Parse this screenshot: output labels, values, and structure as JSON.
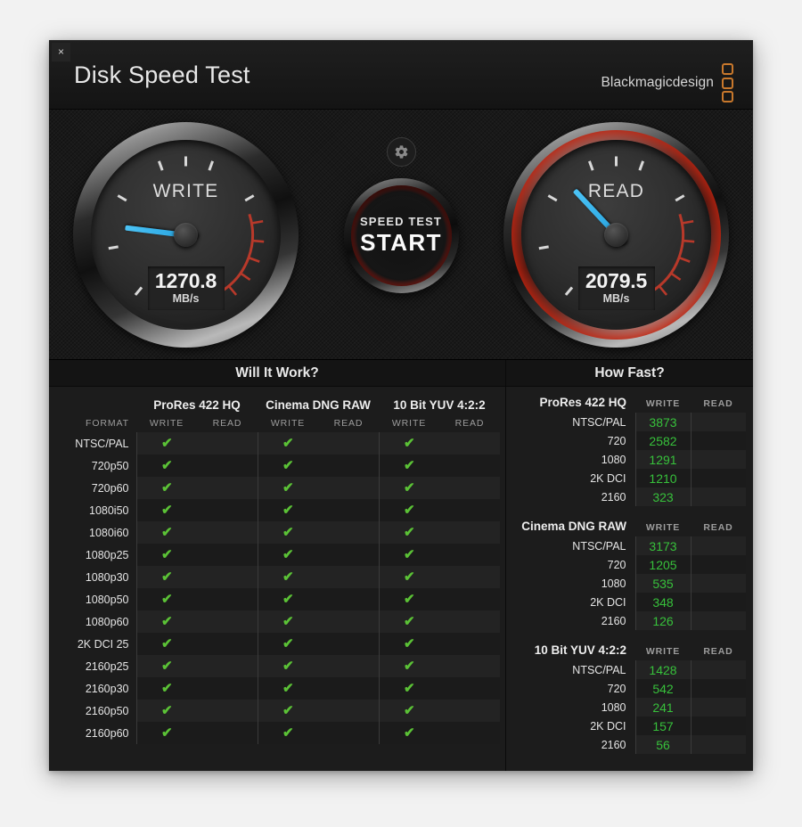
{
  "window": {
    "close_label": "×",
    "title": "Disk Speed Test",
    "brand": "Blackmagicdesign"
  },
  "gauges": {
    "write": {
      "label": "WRITE",
      "value": "1270.8",
      "unit": "MB/s",
      "needle_angle_deg": 187
    },
    "read": {
      "label": "READ",
      "value": "2079.5",
      "unit": "MB/s",
      "needle_angle_deg": 227
    }
  },
  "center": {
    "settings_icon": "gear-icon",
    "start_line1": "SPEED TEST",
    "start_line2": "START"
  },
  "will_it_work": {
    "title": "Will It Work?",
    "format_header": "FORMAT",
    "codecs": [
      "ProRes 422 HQ",
      "Cinema DNG RAW",
      "10 Bit YUV 4:2:2"
    ],
    "sub_headers": [
      "WRITE",
      "READ"
    ],
    "check_glyph": "✔",
    "rows": [
      {
        "format": "NTSC/PAL",
        "cells": [
          true,
          false,
          true,
          false,
          true,
          false
        ]
      },
      {
        "format": "720p50",
        "cells": [
          true,
          false,
          true,
          false,
          true,
          false
        ]
      },
      {
        "format": "720p60",
        "cells": [
          true,
          false,
          true,
          false,
          true,
          false
        ]
      },
      {
        "format": "1080i50",
        "cells": [
          true,
          false,
          true,
          false,
          true,
          false
        ]
      },
      {
        "format": "1080i60",
        "cells": [
          true,
          false,
          true,
          false,
          true,
          false
        ]
      },
      {
        "format": "1080p25",
        "cells": [
          true,
          false,
          true,
          false,
          true,
          false
        ]
      },
      {
        "format": "1080p30",
        "cells": [
          true,
          false,
          true,
          false,
          true,
          false
        ]
      },
      {
        "format": "1080p50",
        "cells": [
          true,
          false,
          true,
          false,
          true,
          false
        ]
      },
      {
        "format": "1080p60",
        "cells": [
          true,
          false,
          true,
          false,
          true,
          false
        ]
      },
      {
        "format": "2K DCI 25",
        "cells": [
          true,
          false,
          true,
          false,
          true,
          false
        ]
      },
      {
        "format": "2160p25",
        "cells": [
          true,
          false,
          true,
          false,
          true,
          false
        ]
      },
      {
        "format": "2160p30",
        "cells": [
          true,
          false,
          true,
          false,
          true,
          false
        ]
      },
      {
        "format": "2160p50",
        "cells": [
          true,
          false,
          true,
          false,
          true,
          false
        ]
      },
      {
        "format": "2160p60",
        "cells": [
          true,
          false,
          true,
          false,
          true,
          false
        ]
      }
    ]
  },
  "how_fast": {
    "title": "How Fast?",
    "col_write": "WRITE",
    "col_read": "READ",
    "blocks": [
      {
        "name": "ProRes 422 HQ",
        "rows": [
          {
            "format": "NTSC/PAL",
            "write": "3873",
            "read": ""
          },
          {
            "format": "720",
            "write": "2582",
            "read": ""
          },
          {
            "format": "1080",
            "write": "1291",
            "read": ""
          },
          {
            "format": "2K DCI",
            "write": "1210",
            "read": ""
          },
          {
            "format": "2160",
            "write": "323",
            "read": ""
          }
        ]
      },
      {
        "name": "Cinema DNG RAW",
        "rows": [
          {
            "format": "NTSC/PAL",
            "write": "3173",
            "read": ""
          },
          {
            "format": "720",
            "write": "1205",
            "read": ""
          },
          {
            "format": "1080",
            "write": "535",
            "read": ""
          },
          {
            "format": "2K DCI",
            "write": "348",
            "read": ""
          },
          {
            "format": "2160",
            "write": "126",
            "read": ""
          }
        ]
      },
      {
        "name": "10 Bit YUV 4:2:2",
        "rows": [
          {
            "format": "NTSC/PAL",
            "write": "1428",
            "read": ""
          },
          {
            "format": "720",
            "write": "542",
            "read": ""
          },
          {
            "format": "1080",
            "write": "241",
            "read": ""
          },
          {
            "format": "2K DCI",
            "write": "157",
            "read": ""
          },
          {
            "format": "2160",
            "write": "56",
            "read": ""
          }
        ]
      }
    ]
  },
  "colors": {
    "accent_green": "#37c13b",
    "check_green": "#5bc236",
    "needle_blue": "#39b4ec",
    "brand_orange": "#c8782c",
    "gauge_red": "#d42818"
  }
}
